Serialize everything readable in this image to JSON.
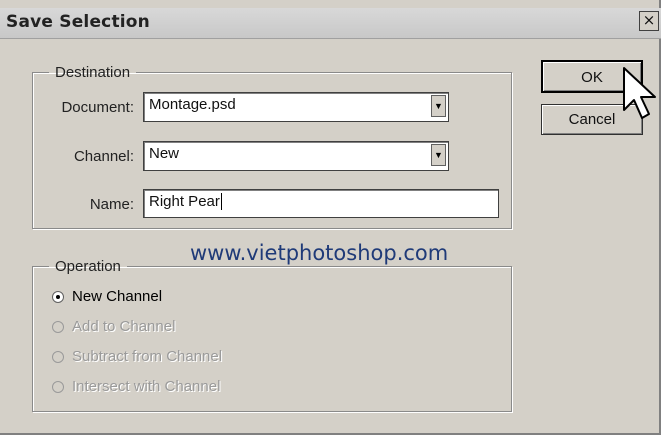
{
  "window": {
    "title": "Save Selection",
    "close_glyph": "×"
  },
  "destination": {
    "legend": "Destination",
    "document_label": "Document:",
    "document_value": "Montage.psd",
    "channel_label": "Channel:",
    "channel_value": "New",
    "name_label": "Name:",
    "name_value": "Right Pear"
  },
  "operation": {
    "legend": "Operation",
    "options": [
      {
        "label": "New Channel",
        "selected": true,
        "enabled": true
      },
      {
        "label": "Add to Channel",
        "selected": false,
        "enabled": false
      },
      {
        "label": "Subtract from Channel",
        "selected": false,
        "enabled": false
      },
      {
        "label": "Intersect with Channel",
        "selected": false,
        "enabled": false
      }
    ]
  },
  "buttons": {
    "ok": "OK",
    "cancel": "Cancel"
  },
  "watermark": "www.vietphotoshop.com",
  "icons": {
    "dropdown": "chevron-down-icon",
    "cursor": "mouse-pointer-icon",
    "close": "close-icon"
  }
}
